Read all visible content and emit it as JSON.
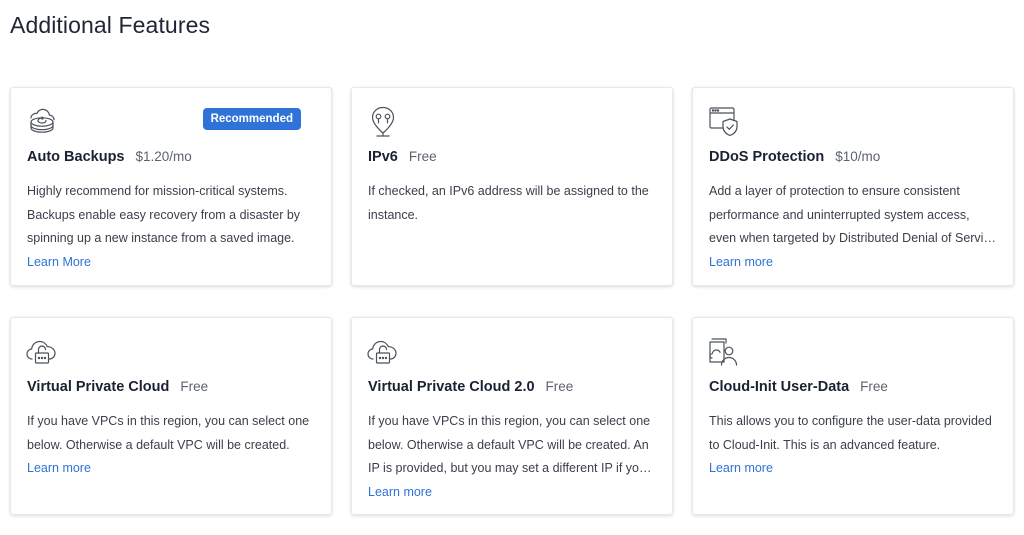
{
  "page": {
    "title": "Additional Features"
  },
  "cards": [
    {
      "title": "Auto Backups",
      "price": "$1.20/mo",
      "badge": "Recommended",
      "icon": "backup-disk-icon",
      "description": "Highly recommend for mission-critical systems. Backups enable easy recovery from a disaster by spinning up a new instance from a saved image.",
      "link": "Learn More"
    },
    {
      "title": "IPv6",
      "price": "Free",
      "icon": "ip-location-icon",
      "description": "If checked, an IPv6 address will be assigned to the instance.",
      "link": ""
    },
    {
      "title": "DDoS Protection",
      "price": "$10/mo",
      "icon": "browser-shield-icon",
      "description": "Add a layer of protection to ensure consistent performance and uninterrupted system access, even when targeted by Distributed Denial of Service attacks.",
      "link": "Learn more"
    },
    {
      "title": "Virtual Private Cloud",
      "price": "Free",
      "icon": "cloud-lock-icon",
      "description": "If you have VPCs in this region, you can select one below. Otherwise a default VPC will be created.",
      "link": "Learn more"
    },
    {
      "title": "Virtual Private Cloud 2.0",
      "price": "Free",
      "icon": "cloud-lock-icon",
      "description": "If you have VPCs in this region, you can select one below. Otherwise a default VPC will be created. An IP is provided, but you may set a different IP if you wish.",
      "link": "Learn more"
    },
    {
      "title": "Cloud-Init User-Data",
      "price": "Free",
      "icon": "cloud-user-data-icon",
      "description": "This allows you to configure the user-data provided to Cloud-Init. This is an advanced feature.",
      "link": "Learn more"
    }
  ]
}
